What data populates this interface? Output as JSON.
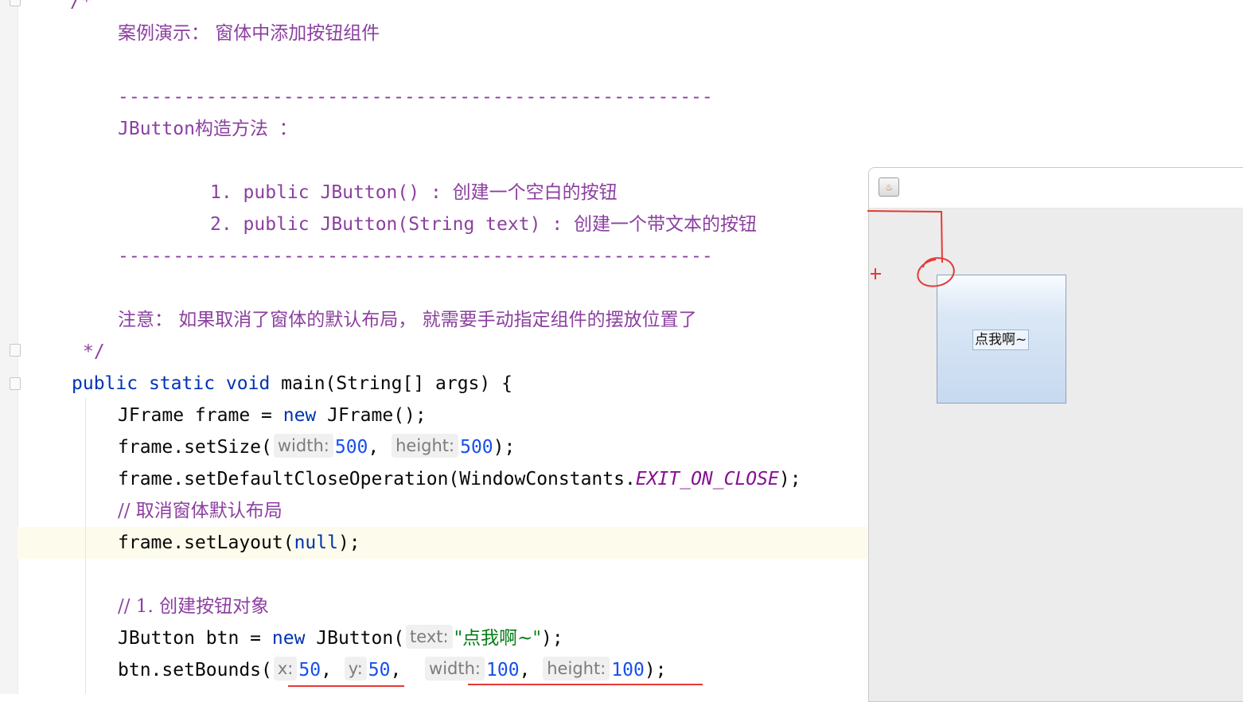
{
  "editor": {
    "top_comment_fragment": "/*",
    "comment_title": "案例演示： 窗体中添加按钮组件",
    "separator": "------------------------------------------------------",
    "constructors_heading": "JButton构造方法 ：",
    "constructor_1": "1. public JButton() : 创建一个空白的按钮",
    "constructor_2": "2. public JButton(String text) : 创建一个带文本的按钮",
    "note": "注意： 如果取消了窗体的默认布局， 就需要手动指定组件的摆放位置了",
    "comment_end": "*/",
    "main_sig": {
      "public": "public",
      "static": "static",
      "void": "void",
      "rest": "main(String[] args) {"
    },
    "line_jframe": {
      "pre": "JFrame frame = ",
      "new": "new",
      "post": " JFrame();"
    },
    "line_setsize": {
      "pre": "frame.setSize(",
      "hint_width": "width:",
      "width": "500",
      "comma": ", ",
      "hint_height": "height:",
      "height": "500",
      "post": ");"
    },
    "line_close": {
      "pre": "frame.setDefaultCloseOperation(WindowConstants.",
      "const": "EXIT_ON_CLOSE",
      "post": ");"
    },
    "comment_layout": "// 取消窗体默认布局",
    "line_layout": {
      "pre": "frame.setLayout(",
      "null": "null",
      "post": ");"
    },
    "comment_step1": "// 1. 创建按钮对象",
    "line_btn": {
      "pre": "JButton btn = ",
      "new": "new",
      "mid": " JButton(",
      "hint_text": "text:",
      "str": "\"点我啊~\"",
      "post": ");"
    },
    "line_bounds": {
      "pre": "btn.setBounds(",
      "hint_x": "x:",
      "x": "50",
      "c1": ", ",
      "hint_y": "y:",
      "y": "50",
      "c2": ",  ",
      "hint_w": "width:",
      "w": "100",
      "c3": ", ",
      "hint_h": "height:",
      "h": "100",
      "post": ");"
    }
  },
  "java_window": {
    "icon": "java-cup-icon",
    "icon_glyph": "♨",
    "button_label": "点我啊~"
  },
  "colors": {
    "comment": "#8c3fa0",
    "keyword": "#0033b3",
    "number": "#1750eb",
    "string": "#067d17",
    "annotation_red": "#e53935"
  }
}
